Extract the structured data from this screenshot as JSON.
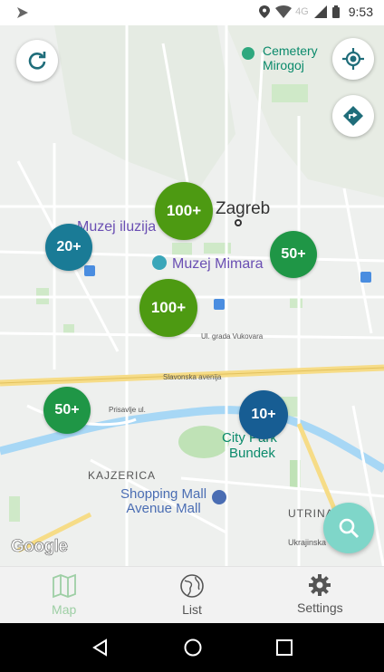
{
  "status_bar": {
    "network": "4G",
    "time": "9:53"
  },
  "map": {
    "labels": {
      "city": "Zagreb",
      "cemetery": "Cemetery",
      "cemetery_sub": "Mirogoj",
      "muzej_iluzija": "Muzej iluzija",
      "muzej_mimara": "Muzej Mimara",
      "city_park": "City Park",
      "city_park_sub": "Bundek",
      "kajzerica": "KAJZERICA",
      "shopping_mall": "Shopping Mall",
      "shopping_mall_sub": "Avenue Mall",
      "utrina": "UTRINA",
      "slavonska": "Slavonska avenija",
      "vukovara": "Ul. grada Vukovara",
      "ukrajinska": "Ukrajinska",
      "prisavlje": "Prisavlje ul.",
      "google": "Google"
    },
    "clusters": [
      {
        "label": "100+",
        "color": "#4d9a12"
      },
      {
        "label": "20+",
        "color": "#1a7b96"
      },
      {
        "label": "50+",
        "color": "#1f9646"
      },
      {
        "label": "100+",
        "color": "#4d9a12"
      },
      {
        "label": "50+",
        "color": "#1f9646"
      },
      {
        "label": "10+",
        "color": "#175d93"
      }
    ],
    "buttons": {
      "refresh_icon": "refresh-icon",
      "locate_icon": "my-location-icon",
      "route_icon": "directions-icon",
      "search_icon": "search-icon"
    }
  },
  "tabs": [
    {
      "label": "Map",
      "icon": "map-icon",
      "active": true
    },
    {
      "label": "List",
      "icon": "globe-icon",
      "active": false
    },
    {
      "label": "Settings",
      "icon": "gear-icon",
      "active": false
    }
  ],
  "nav": {
    "back_icon": "back-icon",
    "home_icon": "home-icon",
    "recents_icon": "recents-icon"
  },
  "colors": {
    "accent": "#7fd6c9",
    "active_tab": "#9ecfa5"
  }
}
